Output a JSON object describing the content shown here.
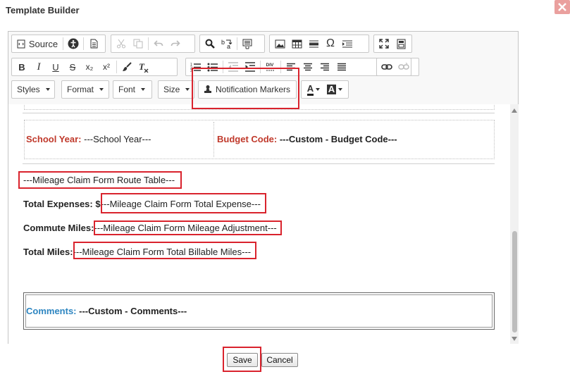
{
  "dialog": {
    "title": "Template Builder",
    "close_icon": "close-icon"
  },
  "toolbar": {
    "source_label": "Source",
    "combos": {
      "styles": "Styles",
      "format": "Format",
      "font": "Font",
      "size": "Size",
      "notification_markers": "Notification Markers"
    },
    "glyphs": {
      "bold": "B",
      "italic": "I",
      "underline": "U",
      "strike": "S",
      "subscript": "x₂",
      "superscript": "x²",
      "special_char": "Ω",
      "text_color": "A",
      "bg_color": "A",
      "div": "DIV"
    }
  },
  "content": {
    "school_year_label": "School Year:",
    "school_year_value": "---School Year---",
    "budget_code_label": "Budget Code:",
    "budget_code_value": "---Custom - Budget Code---",
    "route_table": "---Mileage Claim Form Route Table---",
    "total_expenses_label": "Total Expenses: $",
    "total_expenses_value": "---Mileage Claim Form Total Expense---",
    "commute_miles_label": "Commute Miles:",
    "commute_miles_value": "---Mileage Claim Form Mileage Adjustment---",
    "total_miles_label": "Total Miles:",
    "total_miles_value": "---Mileage Claim Form Total Billable Miles---",
    "comments_label": "Comments:",
    "comments_value": "---Custom - Comments---"
  },
  "buttons": {
    "save": "Save",
    "cancel": "Cancel"
  },
  "colors": {
    "highlight_box": "#d9232d",
    "label_red": "#c0392b",
    "label_blue": "#2e86c1"
  }
}
